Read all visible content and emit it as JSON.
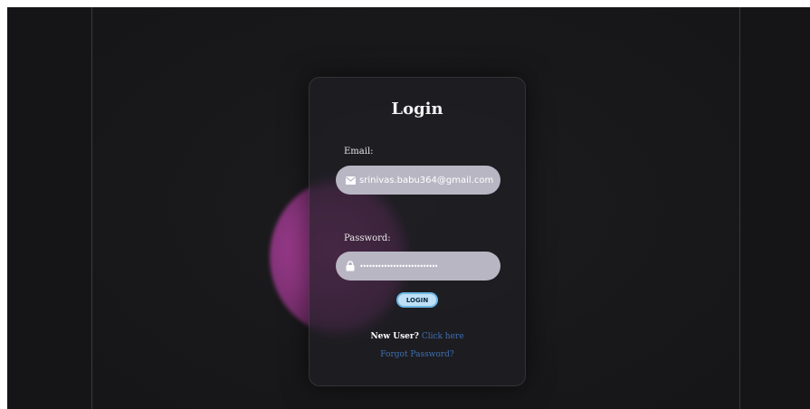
{
  "login_form": {
    "title": "Login",
    "email_label": "Email:",
    "email_value": "srinivas.babu364@gmail.com",
    "email_icon": "envelope-icon",
    "password_label": "Password:",
    "password_value": "••••••••••••••••••••••••••",
    "password_icon": "lock-icon",
    "login_button_label": "LOGIN",
    "new_user_text": "New User?",
    "click_here_link": "Click here",
    "forgot_password_link": "Forgot Password?"
  },
  "colors": {
    "background": "#151517",
    "card": "#1e1e24",
    "input": "#b9b6c3",
    "button": "#bfe0f5",
    "button_border": "#6fb7e4",
    "link": "#3f6fb0",
    "blob": "#b2409a"
  }
}
